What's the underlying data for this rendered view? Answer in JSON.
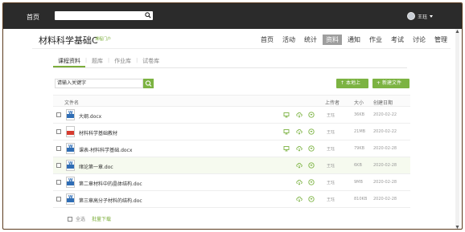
{
  "topbar": {
    "home_label": "首页",
    "search_placeholder": "",
    "user_name": "王珏"
  },
  "header": {
    "course_title": "材料科学基础C",
    "course_sub": "课程门户",
    "nav": [
      "首页",
      "活动",
      "统计",
      "资料",
      "通知",
      "作业",
      "考试",
      "讨论",
      "管理"
    ],
    "nav_active": "资料"
  },
  "subtabs": [
    "课程资料",
    "题库",
    "作业库",
    "试卷库"
  ],
  "subtab_active": "课程资料",
  "search": {
    "keyword_placeholder": "请输入关键字"
  },
  "buttons": {
    "upload": "本地上传",
    "new_folder": "新建文件夹"
  },
  "table": {
    "headers": {
      "name": "文件名",
      "uploader": "上传者",
      "size": "大小",
      "date": "创建日期"
    },
    "rows": [
      {
        "name": "大纲.docx",
        "type": "word",
        "uploader": "王珏",
        "size": "36KB",
        "date": "2020-02-22",
        "has_preview": true
      },
      {
        "name": "材料科学基础教材",
        "type": "pdf",
        "uploader": "王珏",
        "size": "21MB",
        "date": "2020-02-22",
        "has_preview": true
      },
      {
        "name": "课表-材料科学基础.docx",
        "type": "word",
        "uploader": "王珏",
        "size": "79KB",
        "date": "2020-02-28",
        "has_preview": true
      },
      {
        "name": "绪论第一章.doc",
        "type": "word",
        "uploader": "王珏",
        "size": "6KB",
        "date": "2020-02-28",
        "has_preview": false
      },
      {
        "name": "第二章材料中的晶体结构.doc",
        "type": "word",
        "uploader": "王珏",
        "size": "9MB",
        "date": "2020-02-28",
        "has_preview": false
      },
      {
        "name": "第三章高分子材料的结构.doc",
        "type": "word",
        "uploader": "王珏",
        "size": "810KB",
        "date": "2020-02-28",
        "has_preview": false
      }
    ]
  },
  "footer": {
    "select_all": "全选",
    "batch_download": "批量下载"
  },
  "colors": {
    "accent_green": "#7cb342",
    "topbar": "#2b2b2b"
  }
}
